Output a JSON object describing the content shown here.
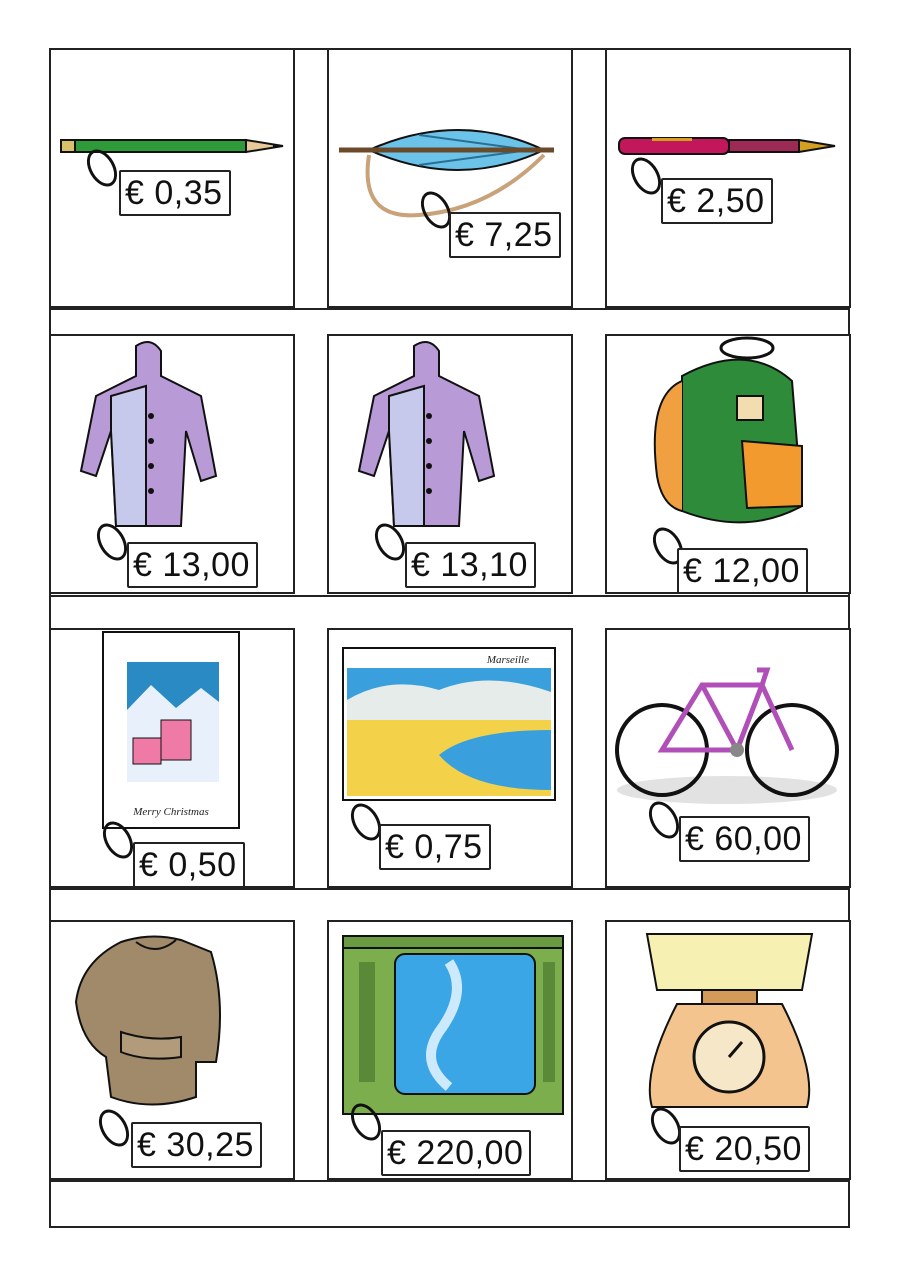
{
  "items": [
    {
      "name": "pencil",
      "price": "€ 0,35"
    },
    {
      "name": "umbrella",
      "price": "€ 7,25"
    },
    {
      "name": "fountain-pen",
      "price": "€ 2,50"
    },
    {
      "name": "raincoat",
      "price": "€ 13,00"
    },
    {
      "name": "raincoat",
      "price": "€ 13,10"
    },
    {
      "name": "backpack",
      "price": "€ 12,00"
    },
    {
      "name": "christmas-card",
      "price": "€ 0,50",
      "card_text": "Merry Christmas"
    },
    {
      "name": "postcard",
      "price": "€ 0,75",
      "card_text": "Marseille"
    },
    {
      "name": "bicycle",
      "price": "€ 60,00"
    },
    {
      "name": "sweater",
      "price": "€ 30,25"
    },
    {
      "name": "television",
      "price": "€ 220,00"
    },
    {
      "name": "kitchen-scale",
      "price": "€ 20,50"
    }
  ]
}
